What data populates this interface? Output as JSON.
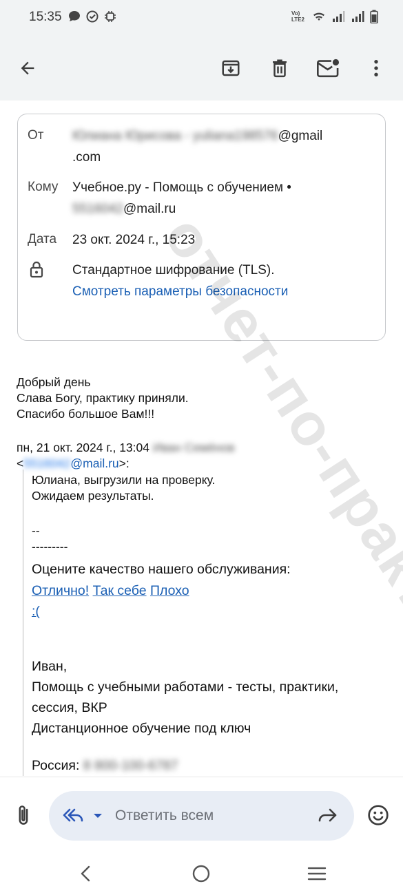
{
  "status_bar": {
    "time": "15:35",
    "network_label": "Vo) LTE2"
  },
  "app_bar": {
    "icons": [
      "back-arrow-icon",
      "archive-icon",
      "delete-icon",
      "mark-unread-icon",
      "more-vert-icon"
    ]
  },
  "details": {
    "from_label": "От",
    "from_name": "Юлиана Юрисова",
    "from_email_user": "yuliana198576",
    "from_email_domain": "@gmail",
    "from_email_tld": ".com",
    "to_label": "Кому",
    "to_name": "Учебное.ру - Помощь с обучением •",
    "to_email_user": "5516042",
    "to_email_domain": "@mail.ru",
    "date_label": "Дата",
    "date_value": "23 окт. 2024 г., 15:23",
    "encryption_text": "Стандартное шифрование (TLS).",
    "security_link": "Смотреть параметры безопасности"
  },
  "body": {
    "line1": "Добрый день",
    "line2": "Слава Богу, практику приняли.",
    "line3": "Спасибо большое Вам!!!",
    "quote_header_date": "пн, 21 окт. 2024 г., 13:04",
    "quote_header_name": "Иван Семёнов",
    "quote_header_lt": "<",
    "quote_header_email_user": "5516042",
    "quote_header_email_domain": "@mail.ru",
    "quote_header_gt": ">:"
  },
  "quote": {
    "line1": "Юлиана, выгрузили на проверку.",
    "line2": "Ожидаем результаты.",
    "sig_dashes1": "--",
    "sig_dashes2": "---------",
    "rate_prompt": "Оцените качество нашего обслуживания:",
    "rate_excellent": "Отлично!",
    "rate_so_so": "Так себе",
    "rate_bad": "Плохо",
    "rate_sad": ":(",
    "sig_name": "Иван,",
    "sig_line2": "Помощь с учебными работами - тесты, практики,",
    "sig_line3": "сессия, ВКР",
    "sig_line4": "Дистанционное обучение под ключ",
    "country_label": "Россия:",
    "phone": "8 800-100-6787"
  },
  "watermark": "отчет-по-практике.рф",
  "reply_bar": {
    "placeholder": "Ответить всем"
  },
  "colors": {
    "link": "#1a5fb4",
    "header_bg": "#f1f3f4",
    "reply_pill_bg": "#e8edf5"
  }
}
